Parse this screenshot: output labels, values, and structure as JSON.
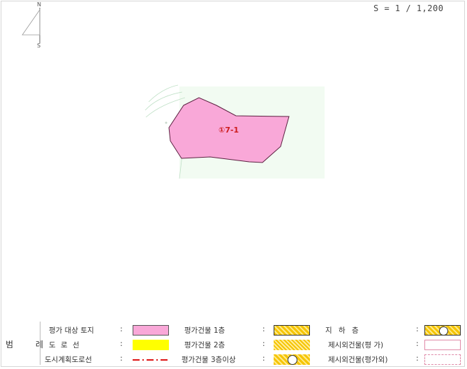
{
  "scale_text": "S = 1 / 1,200",
  "compass": {
    "north": "N",
    "south": "S"
  },
  "parcel": {
    "label": "①7-1",
    "fill": "#f9a8d8",
    "stroke": "#5b2040"
  },
  "colors": {
    "land": "#f2fbf2",
    "road": "#ffff00",
    "plan_road": "#dd1111",
    "building": "#f5c400"
  },
  "legend": {
    "title": "범 례",
    "items": {
      "target_land": "평가 대상 토지",
      "road_line": "도  로  선",
      "plan_road": "도시계획도로선",
      "bldg1": "평가건물  1층",
      "bldg2": "평가건물  2층",
      "bldg3": "평가건물 3층이상",
      "basement": "지    하    층",
      "other_bldg1": "제시외건물(평  가)",
      "other_bldg2": "제시외건물(평가외)"
    },
    "colon": ":"
  }
}
